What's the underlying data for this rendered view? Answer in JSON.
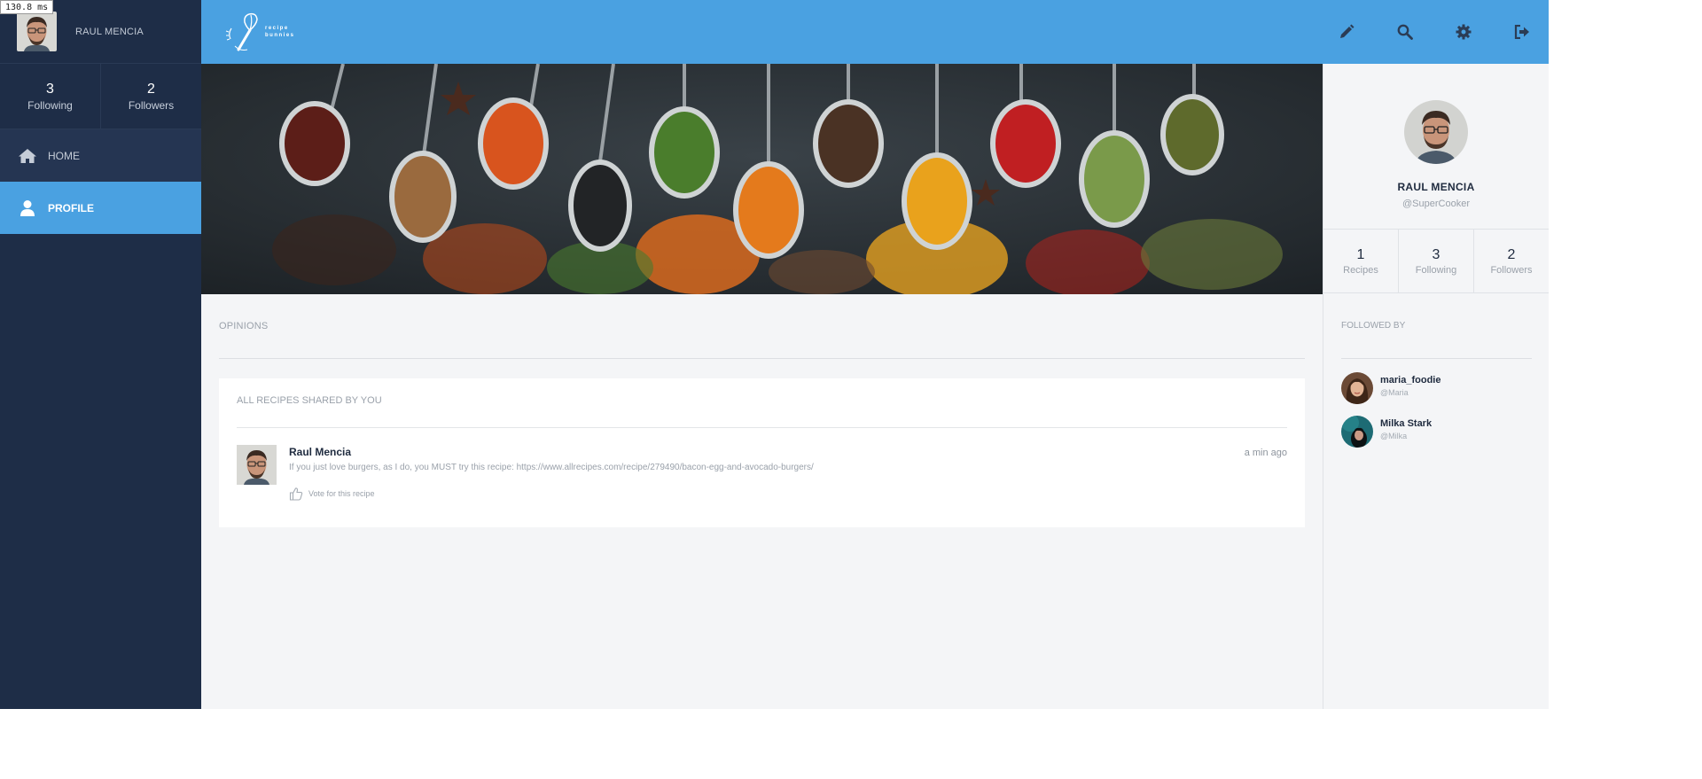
{
  "timing_overlay": "130.8 ms",
  "sidebar": {
    "user_name": "RAUL MENCIA",
    "stats": [
      {
        "value": "3",
        "label": "Following"
      },
      {
        "value": "2",
        "label": "Followers"
      }
    ],
    "nav": [
      {
        "label": "HOME",
        "icon": "home-icon"
      },
      {
        "label": "PROFILE",
        "icon": "user-icon",
        "active": true
      }
    ]
  },
  "topbar": {
    "logo_line1": "recipe",
    "logo_line2": "bunnies",
    "icons": [
      "edit-icon",
      "search-icon",
      "settings-icon",
      "logout-icon"
    ]
  },
  "main": {
    "opinions_label": "OPINIONS",
    "card": {
      "title": "ALL RECIPES SHARED BY YOU",
      "post": {
        "author": "Raul Mencia",
        "time": "a min ago",
        "text": "If you just love burgers, as I do, you MUST try this recipe: https://www.allrecipes.com/recipe/279490/bacon-egg-and-avocado-burgers/",
        "vote_label": "Vote for this recipe"
      }
    }
  },
  "profile": {
    "name": "RAUL MENCIA",
    "handle": "@SuperCooker",
    "stats": [
      {
        "value": "1",
        "label": "Recipes"
      },
      {
        "value": "3",
        "label": "Following"
      },
      {
        "value": "2",
        "label": "Followers"
      }
    ],
    "followed_by_label": "FOLLOWED BY",
    "followers": [
      {
        "name": "maria_foodie",
        "handle": "@Maria"
      },
      {
        "name": "Milka Stark",
        "handle": "@Milka"
      }
    ]
  },
  "colors": {
    "sidebar_bg": "#1e2d47",
    "accent": "#4aa1e1",
    "content_bg": "#f4f5f7"
  }
}
